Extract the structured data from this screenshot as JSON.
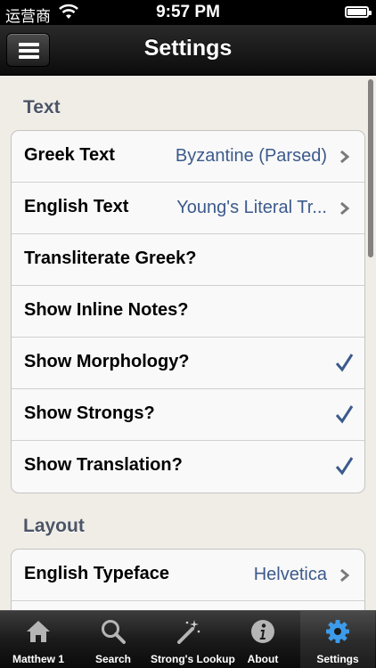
{
  "status_bar": {
    "carrier": "运营商",
    "time": "9:57 PM"
  },
  "nav": {
    "title": "Settings",
    "menu_icon": "hamburger-menu-icon"
  },
  "sections": [
    {
      "header": "Text",
      "rows": [
        {
          "label": "Greek Text",
          "value": "Byzantine (Parsed)",
          "accessory": "chevron"
        },
        {
          "label": "English Text",
          "value": "Young's Literal Tr...",
          "accessory": "chevron"
        },
        {
          "label": "Transliterate Greek?",
          "checked": false
        },
        {
          "label": "Show Inline Notes?",
          "checked": false
        },
        {
          "label": "Show Morphology?",
          "checked": true
        },
        {
          "label": "Show Strongs?",
          "checked": true
        },
        {
          "label": "Show Translation?",
          "checked": true
        }
      ]
    },
    {
      "header": "Layout",
      "rows": [
        {
          "label": "English Typeface",
          "value": "Helvetica",
          "accessory": "chevron"
        }
      ]
    }
  ],
  "tabs": [
    {
      "label": "Matthew 1",
      "icon": "home-icon"
    },
    {
      "label": "Search",
      "icon": "search-icon"
    },
    {
      "label": "Strong's Lookup",
      "icon": "magic-wand-icon"
    },
    {
      "label": "About",
      "icon": "info-icon"
    },
    {
      "label": "Settings",
      "icon": "gear-icon",
      "selected": true
    }
  ],
  "colors": {
    "value_text": "#3c5a8c",
    "checkmark": "#3c5a8c",
    "section_header": "#4c5566",
    "background": "#efede6",
    "selected_tab_icon": "#3d9be9"
  }
}
